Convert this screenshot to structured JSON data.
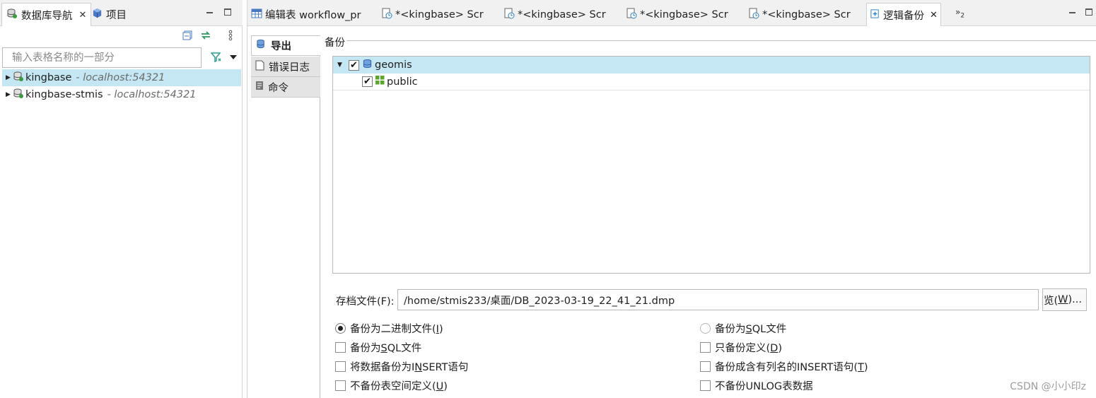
{
  "left_panel": {
    "tabs": [
      {
        "label": "数据库导航",
        "icon": "database-navigator-icon",
        "closable": true
      },
      {
        "label": "项目",
        "icon": "cube-icon",
        "closable": false
      }
    ],
    "filter_placeholder": "输入表格名称的一部分",
    "connections": [
      {
        "name": "kingbase",
        "host": "- localhost:54321",
        "selected": true
      },
      {
        "name": "kingbase-stmis",
        "host": "- localhost:54321",
        "selected": false
      }
    ]
  },
  "editor": {
    "tabs": [
      {
        "label": "编辑表 workflow_pr",
        "icon": "table-icon"
      },
      {
        "label": "*<kingbase> Scr",
        "icon": "sql-script-icon"
      },
      {
        "label": "*<kingbase> Scr",
        "icon": "sql-script-icon"
      },
      {
        "label": "*<kingbase> Scr",
        "icon": "sql-script-icon"
      },
      {
        "label": "*<kingbase> Scr",
        "icon": "sql-script-icon"
      },
      {
        "label": "逻辑备份",
        "icon": "backup-icon",
        "active": true
      }
    ],
    "more_tabs": "»",
    "more_tabs_count": "2",
    "side_tabs": [
      {
        "label": "导出",
        "icon": "database-export-icon",
        "active": true
      },
      {
        "label": "错误日志",
        "icon": "document-icon"
      },
      {
        "label": "命令",
        "icon": "command-icon"
      }
    ],
    "backup_group_label": "备份",
    "schema_tree": {
      "database": {
        "name": "geomis",
        "checked": true
      },
      "schemas": [
        {
          "name": "public",
          "checked": true
        }
      ]
    },
    "archive": {
      "label": "存档文件(F):",
      "value": "/home/stmis233/桌面/DB_2023-03-19_22_41_21.dmp",
      "browse_pre": "览(",
      "browse_key": "W",
      "browse_post": ")..."
    },
    "options": {
      "radio_binary": {
        "pre": "备份为二进制文件(",
        "key": "I",
        "post": ")",
        "selected": true
      },
      "radio_sql": {
        "pre": "备份为",
        "key": "S",
        "post": "QL文件",
        "selected": false
      },
      "cb_sql": {
        "pre": "备份为",
        "key": "S",
        "post": "QL文件",
        "checked": false
      },
      "cb_defs": {
        "pre": "只备份定义(",
        "key": "D",
        "post": ")",
        "checked": false
      },
      "cb_insert": {
        "pre": "将数据备份为I",
        "key": "N",
        "post": "SERT语句",
        "checked": false
      },
      "cb_insert_cols": {
        "pre": "备份成含有列名的INSERT语句(",
        "key": "T",
        "post": ")",
        "checked": false
      },
      "cb_no_tablespace": {
        "pre": "不备份表空间定义(",
        "key": "U",
        "post": ")",
        "checked": false
      },
      "cb_no_unlog": {
        "pre": "不备份UNLOG表数据",
        "key": "",
        "post": "",
        "checked": false
      }
    }
  },
  "watermark": "CSDN @小小印z",
  "colors": {
    "selection": "#c5e7f3",
    "tab_bar": "#f1f1f1"
  }
}
